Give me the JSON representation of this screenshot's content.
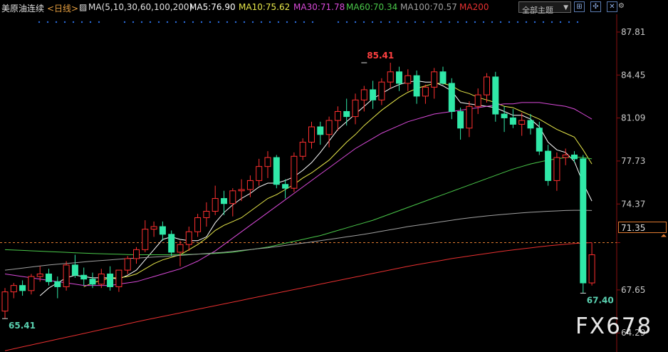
{
  "toolbar": {
    "symbol": "美原油连续",
    "period": "<日线>",
    "ma_params": "MA(5,10,30,60,100,200)",
    "ma5": "MA5:76.90",
    "ma10": "MA10:75.62",
    "ma30": "MA30:71.78",
    "ma60": "MA60:70.34",
    "ma100": "MA100:70.57",
    "ma200": "MA200",
    "theme": "全部主题",
    "colors": {
      "ma5": "#ffffff",
      "ma10": "#e8e84a",
      "ma30": "#d94ad9",
      "ma60": "#4ac84a",
      "ma100": "#a0a0a0",
      "ma200": "#e83030"
    }
  },
  "watermark": "FX678",
  "current_price_label": "71.35",
  "chart_data": {
    "type": "candlestick",
    "ylim": [
      62.8,
      89.2
    ],
    "yticks": [
      "87.81",
      "84.45",
      "81.09",
      "77.73",
      "74.37",
      "71.35",
      "67.65",
      "64.29"
    ],
    "ytick_values": [
      87.81,
      84.45,
      81.09,
      77.73,
      74.37,
      71.35,
      67.65,
      64.29
    ],
    "annotations": [
      {
        "text": "85.41",
        "candle": 41,
        "value": 85.41,
        "color": "#ff4040"
      },
      {
        "text": "65.41",
        "candle": 0,
        "value": 65.41,
        "color": "#5ad0b0"
      },
      {
        "text": "67.40",
        "candle": 66,
        "value": 67.4,
        "color": "#5ad0b0"
      }
    ],
    "current_price": 71.35,
    "candles": [
      [
        66.0,
        67.8,
        65.41,
        67.5
      ],
      [
        67.5,
        68.2,
        67.0,
        68.0
      ],
      [
        68.0,
        68.4,
        67.2,
        67.6
      ],
      [
        67.6,
        68.9,
        67.3,
        68.7
      ],
      [
        68.7,
        69.5,
        68.3,
        68.9
      ],
      [
        68.9,
        69.3,
        68.0,
        68.3
      ],
      [
        68.3,
        68.7,
        67.0,
        67.9
      ],
      [
        67.9,
        69.9,
        67.6,
        69.6
      ],
      [
        69.6,
        70.4,
        68.6,
        68.8
      ],
      [
        68.8,
        69.4,
        68.0,
        68.5
      ],
      [
        68.5,
        69.0,
        67.8,
        68.1
      ],
      [
        68.1,
        69.3,
        67.8,
        68.9
      ],
      [
        68.9,
        69.5,
        67.6,
        67.9
      ],
      [
        67.9,
        69.2,
        67.5,
        69.2
      ],
      [
        69.2,
        70.3,
        68.9,
        70.1
      ],
      [
        70.1,
        71.0,
        69.7,
        70.8
      ],
      [
        70.8,
        73.1,
        70.6,
        72.4
      ],
      [
        72.4,
        73.0,
        71.8,
        72.6
      ],
      [
        72.6,
        73.0,
        71.5,
        72.0
      ],
      [
        72.0,
        72.3,
        70.3,
        70.6
      ],
      [
        70.6,
        71.5,
        69.5,
        71.2
      ],
      [
        71.2,
        72.6,
        70.7,
        72.2
      ],
      [
        72.2,
        73.6,
        71.8,
        73.3
      ],
      [
        73.3,
        74.5,
        72.6,
        73.8
      ],
      [
        73.8,
        75.8,
        73.5,
        74.8
      ],
      [
        74.8,
        75.4,
        73.5,
        74.4
      ],
      [
        74.4,
        75.6,
        73.4,
        75.4
      ],
      [
        75.4,
        76.3,
        74.6,
        75.5
      ],
      [
        75.5,
        76.6,
        74.9,
        76.2
      ],
      [
        76.2,
        77.9,
        75.8,
        77.3
      ],
      [
        77.3,
        78.5,
        76.4,
        78.0
      ],
      [
        78.0,
        78.2,
        75.6,
        75.9
      ],
      [
        75.9,
        76.3,
        74.8,
        75.6
      ],
      [
        75.6,
        78.4,
        75.3,
        78.1
      ],
      [
        78.1,
        79.5,
        77.8,
        79.2
      ],
      [
        79.2,
        80.8,
        78.7,
        80.4
      ],
      [
        80.4,
        80.8,
        79.0,
        79.8
      ],
      [
        79.8,
        81.2,
        78.8,
        80.9
      ],
      [
        80.9,
        82.0,
        80.1,
        81.6
      ],
      [
        81.6,
        82.6,
        80.5,
        81.2
      ],
      [
        81.2,
        83.0,
        80.6,
        82.5
      ],
      [
        82.5,
        83.6,
        81.6,
        83.3
      ],
      [
        83.3,
        84.0,
        81.8,
        82.5
      ],
      [
        82.5,
        84.2,
        82.1,
        83.9
      ],
      [
        83.9,
        85.41,
        83.4,
        84.7
      ],
      [
        84.7,
        85.1,
        83.2,
        83.8
      ],
      [
        83.8,
        84.9,
        83.2,
        84.4
      ],
      [
        84.4,
        84.8,
        82.2,
        82.8
      ],
      [
        82.8,
        83.7,
        82.2,
        83.5
      ],
      [
        83.5,
        85.0,
        82.6,
        84.7
      ],
      [
        84.7,
        85.1,
        83.7,
        83.8
      ],
      [
        83.8,
        84.2,
        81.0,
        81.6
      ],
      [
        81.6,
        81.9,
        79.4,
        80.3
      ],
      [
        80.3,
        82.4,
        79.6,
        82.0
      ],
      [
        82.0,
        83.4,
        81.4,
        82.9
      ],
      [
        82.9,
        84.6,
        82.3,
        84.3
      ],
      [
        84.3,
        84.7,
        80.8,
        81.4
      ],
      [
        81.4,
        82.0,
        80.0,
        81.1
      ],
      [
        81.1,
        81.8,
        80.3,
        80.6
      ],
      [
        80.6,
        81.5,
        79.7,
        80.9
      ],
      [
        80.9,
        81.4,
        79.8,
        80.3
      ],
      [
        80.3,
        80.8,
        78.2,
        78.5
      ],
      [
        78.5,
        79.0,
        75.8,
        76.2
      ],
      [
        76.2,
        78.4,
        75.4,
        78.0
      ],
      [
        78.0,
        78.7,
        77.4,
        78.2
      ],
      [
        78.2,
        78.5,
        77.6,
        77.9
      ],
      [
        77.9,
        78.2,
        67.4,
        68.2
      ],
      [
        68.2,
        71.35,
        68.0,
        70.4
      ]
    ],
    "series": [
      {
        "name": "MA5",
        "color": "#ffffff",
        "values": [
          null,
          null,
          null,
          null,
          67.2,
          67.8,
          68.2,
          68.6,
          68.8,
          68.7,
          68.6,
          68.6,
          68.6,
          68.5,
          68.8,
          69.2,
          70.0,
          70.8,
          71.6,
          71.8,
          71.6,
          71.5,
          71.5,
          71.8,
          72.9,
          73.7,
          74.3,
          74.8,
          75.2,
          75.7,
          76.0,
          76.0,
          76.2,
          76.5,
          77.0,
          77.6,
          78.4,
          79.3,
          80.2,
          80.8,
          81.4,
          82.0,
          82.6,
          83.0,
          83.4,
          83.7,
          83.9,
          84.0,
          83.9,
          83.9,
          83.6,
          83.2,
          82.3,
          82.2,
          82.1,
          82.0,
          81.9,
          81.6,
          81.3,
          81.3,
          81.0,
          80.4,
          79.2,
          78.6,
          78.4,
          77.7,
          76.0,
          74.6
        ]
      },
      {
        "name": "MA10",
        "color": "#e8e84a",
        "values": [
          null,
          null,
          null,
          null,
          null,
          null,
          null,
          null,
          null,
          67.9,
          68.2,
          68.4,
          68.6,
          68.6,
          68.7,
          68.9,
          69.3,
          69.7,
          70.0,
          70.2,
          70.4,
          70.8,
          71.2,
          71.7,
          72.3,
          72.7,
          73.0,
          73.3,
          73.8,
          74.3,
          74.8,
          75.1,
          75.5,
          75.9,
          76.4,
          76.8,
          77.3,
          77.8,
          78.5,
          79.2,
          79.8,
          80.5,
          81.1,
          81.7,
          82.2,
          82.7,
          83.1,
          83.4,
          83.6,
          83.8,
          83.8,
          83.6,
          83.2,
          83.0,
          82.7,
          82.5,
          82.3,
          82.0,
          81.9,
          81.6,
          81.3,
          81.0,
          80.6,
          80.2,
          79.9,
          79.6,
          78.6,
          77.5
        ]
      },
      {
        "name": "MA30",
        "color": "#d94ad9",
        "values": [
          68.9,
          68.8,
          68.7,
          68.6,
          68.5,
          68.4,
          68.3,
          68.2,
          68.1,
          68.0,
          68.0,
          68.0,
          68.0,
          68.1,
          68.2,
          68.3,
          68.5,
          68.7,
          68.9,
          69.1,
          69.3,
          69.6,
          69.9,
          70.3,
          70.7,
          71.2,
          71.7,
          72.2,
          72.7,
          73.2,
          73.7,
          74.2,
          74.7,
          75.2,
          75.7,
          76.2,
          76.7,
          77.2,
          77.7,
          78.2,
          78.7,
          79.1,
          79.5,
          79.9,
          80.2,
          80.5,
          80.8,
          81.0,
          81.2,
          81.4,
          81.5,
          81.6,
          81.7,
          81.8,
          81.9,
          82.0,
          82.1,
          82.2,
          82.2,
          82.3,
          82.3,
          82.3,
          82.2,
          82.1,
          82.0,
          81.8,
          81.4,
          81.0
        ]
      },
      {
        "name": "MA60",
        "color": "#4ac84a",
        "values": [
          70.8,
          70.77,
          70.74,
          70.71,
          70.68,
          70.65,
          70.62,
          70.59,
          70.56,
          70.53,
          70.5,
          70.48,
          70.46,
          70.44,
          70.42,
          70.4,
          70.4,
          70.4,
          70.4,
          70.41,
          70.42,
          70.43,
          70.45,
          70.47,
          70.5,
          70.55,
          70.6,
          70.7,
          70.8,
          70.9,
          71.0,
          71.15,
          71.3,
          71.45,
          71.6,
          71.75,
          71.9,
          72.1,
          72.3,
          72.5,
          72.7,
          72.9,
          73.1,
          73.35,
          73.6,
          73.85,
          74.1,
          74.35,
          74.6,
          74.85,
          75.1,
          75.35,
          75.6,
          75.85,
          76.1,
          76.35,
          76.6,
          76.85,
          77.1,
          77.3,
          77.5,
          77.65,
          77.8,
          77.9,
          78.0,
          78.05,
          78.0,
          77.9
        ]
      },
      {
        "name": "MA100",
        "color": "#a0a0a0",
        "values": [
          69.2,
          69.28,
          69.36,
          69.44,
          69.52,
          69.6,
          69.66,
          69.72,
          69.78,
          69.84,
          69.9,
          69.95,
          70.0,
          70.05,
          70.1,
          70.14,
          70.18,
          70.22,
          70.26,
          70.3,
          70.35,
          70.4,
          70.45,
          70.5,
          70.55,
          70.6,
          70.67,
          70.74,
          70.81,
          70.88,
          70.95,
          71.04,
          71.13,
          71.22,
          71.31,
          71.4,
          71.5,
          71.6,
          71.7,
          71.8,
          71.9,
          72.0,
          72.12,
          72.24,
          72.36,
          72.48,
          72.6,
          72.7,
          72.8,
          72.9,
          73.0,
          73.1,
          73.2,
          73.28,
          73.36,
          73.44,
          73.5,
          73.56,
          73.62,
          73.67,
          73.72,
          73.76,
          73.8,
          73.83,
          73.86,
          73.88,
          73.88,
          73.86
        ]
      },
      {
        "name": "MA200",
        "color": "#e83030",
        "values": [
          62.9,
          63.05,
          63.2,
          63.35,
          63.5,
          63.65,
          63.8,
          63.95,
          64.1,
          64.25,
          64.4,
          64.55,
          64.7,
          64.85,
          65.0,
          65.15,
          65.3,
          65.44,
          65.58,
          65.72,
          65.86,
          66.0,
          66.14,
          66.28,
          66.42,
          66.56,
          66.7,
          66.84,
          66.98,
          67.12,
          67.26,
          67.4,
          67.54,
          67.68,
          67.82,
          67.96,
          68.1,
          68.24,
          68.38,
          68.52,
          68.66,
          68.8,
          68.94,
          69.08,
          69.22,
          69.36,
          69.5,
          69.62,
          69.74,
          69.86,
          69.98,
          70.1,
          70.2,
          70.3,
          70.4,
          70.5,
          70.6,
          70.7,
          70.78,
          70.86,
          70.94,
          71.02,
          71.1,
          71.16,
          71.22,
          71.28,
          71.32,
          71.35
        ]
      }
    ]
  }
}
